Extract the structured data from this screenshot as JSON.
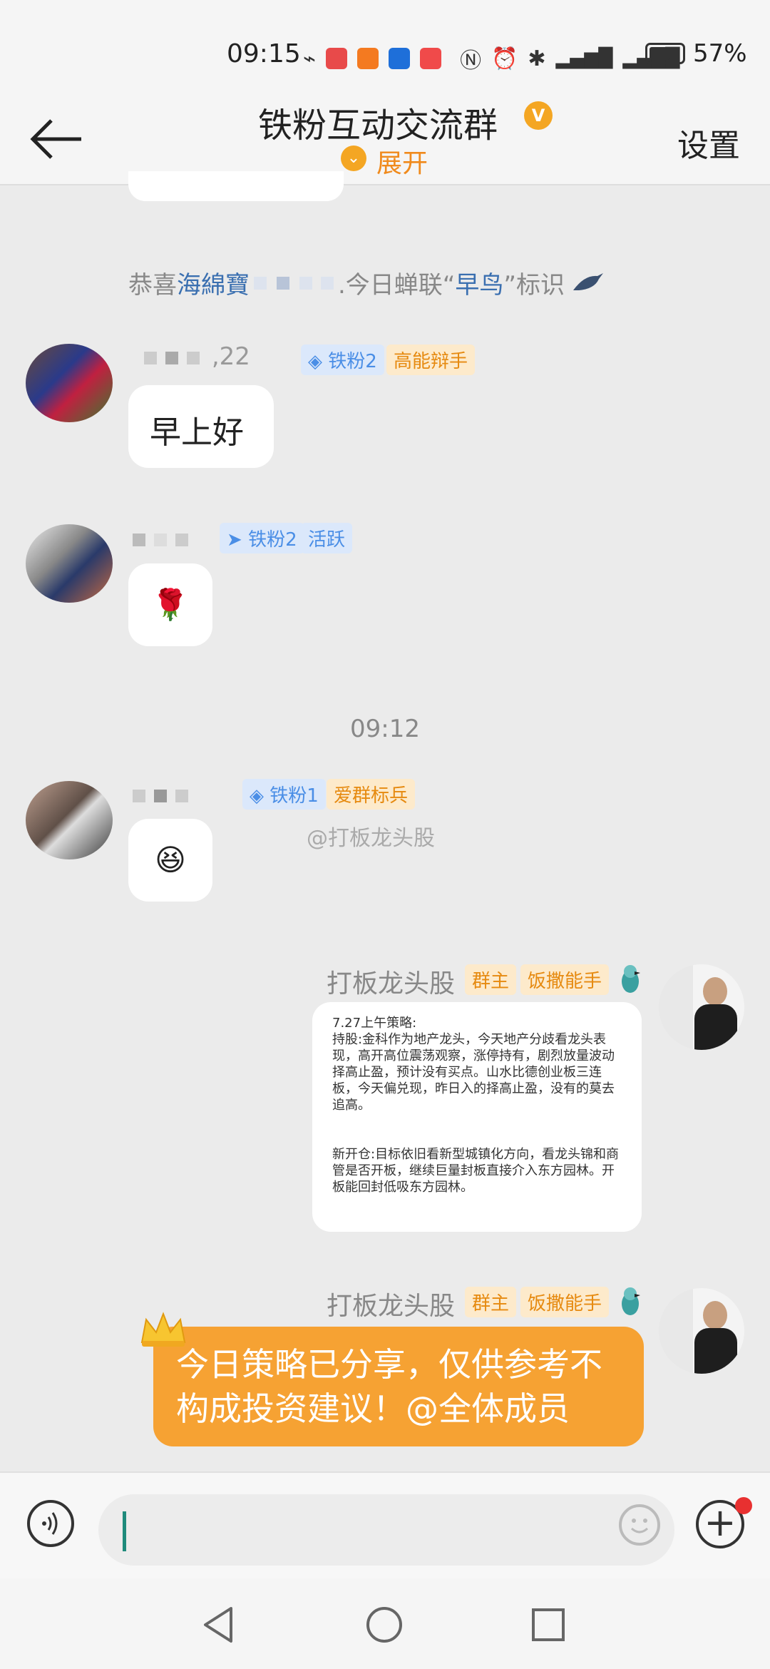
{
  "status_bar": {
    "time": "09:15",
    "battery_pct": "57%",
    "battery_level": 0.57
  },
  "header": {
    "title": "铁粉互动交流群",
    "expand_label": "展开",
    "settings_label": "设置"
  },
  "notice": {
    "prefix": "恭喜",
    "user": "海綿寶",
    "middle": ".今日蝉联“",
    "badge": "早鸟",
    "suffix": "”标识"
  },
  "messages": [
    {
      "name_suffix": ",22",
      "tags": [
        "铁粉2",
        "高能辩手"
      ],
      "text": "早上好"
    },
    {
      "tags": [
        "铁粉2",
        "活跃"
      ],
      "emoji": "🌹"
    },
    {
      "tags": [
        "铁粉1",
        "爱群标兵"
      ],
      "emoji": "😆"
    },
    {
      "name": "打板龙头股",
      "tags": [
        "群主",
        "饭撒能手"
      ],
      "text": "7.27上午策略:\n持股:金科作为地产龙头，今天地产分歧看龙头表现，高开高位震荡观察，涨停持有，剧烈放量波动择高止盈，预计没有买点。山水比德创业板三连板，今天偏兑现，昨日入的择高止盈，没有的莫去追高。\n\n\n新开仓:目标依旧看新型城镇化方向，看龙头锦和商管是否开板，继续巨量封板直接介入东方园林。开板能回封低吸东方园林。"
    },
    {
      "name": "打板龙头股",
      "tags": [
        "群主",
        "饭撒能手"
      ],
      "text": "今日策略已分享，仅供参考不构成投资建议！@全体成员"
    }
  ],
  "time_divider": "09:12",
  "watermark": "@打板龙头股",
  "input": {
    "placeholder": ""
  }
}
